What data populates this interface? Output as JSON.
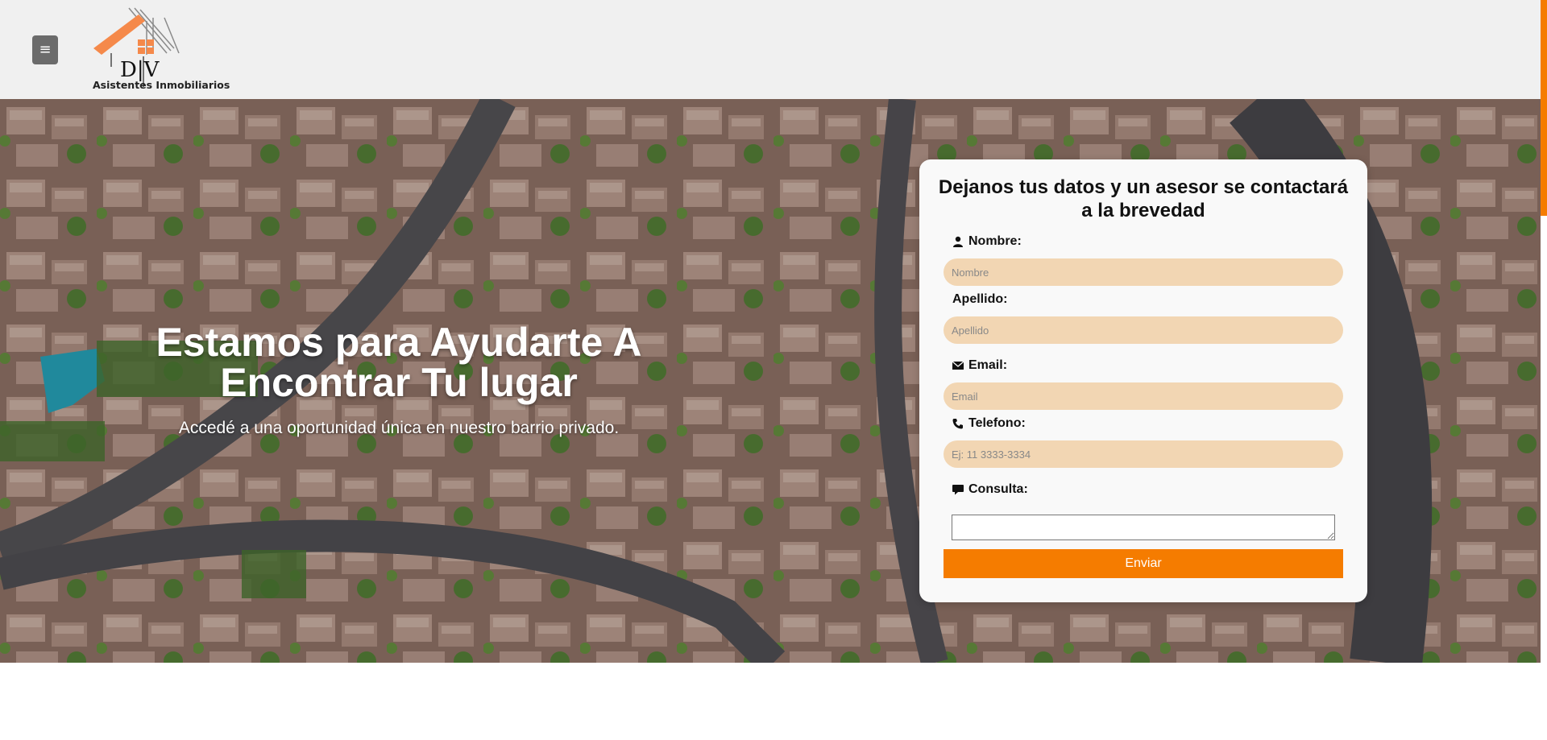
{
  "header": {
    "menu_icon": "hamburger-icon",
    "logo": {
      "letters": "D|V",
      "tagline": "Asistentes Inmobiliarios"
    }
  },
  "hero": {
    "title_line1": "Estamos para Ayudarte A",
    "title_line2": "Encontrar Tu lugar",
    "subtitle": "Accedé a una oportunidad única en nuestro barrio privado."
  },
  "form": {
    "title": "Dejanos tus datos y un asesor se contactará a la brevedad",
    "nombre": {
      "label": "Nombre:",
      "placeholder": "Nombre",
      "icon": "user-icon"
    },
    "apellido": {
      "label": "Apellido:",
      "placeholder": "Apellido"
    },
    "email": {
      "label": "Email:",
      "placeholder": "Email",
      "icon": "envelope-icon"
    },
    "telefono": {
      "label": "Telefono:",
      "placeholder": "Ej: 11 3333-3334",
      "icon": "phone-icon"
    },
    "consulta": {
      "label": "Consulta:",
      "icon": "comment-icon"
    },
    "submit_label": "Enviar"
  },
  "colors": {
    "accent": "#f57c00",
    "input_bg": "#f2d6b3",
    "header_bg": "#f0f0f0"
  }
}
